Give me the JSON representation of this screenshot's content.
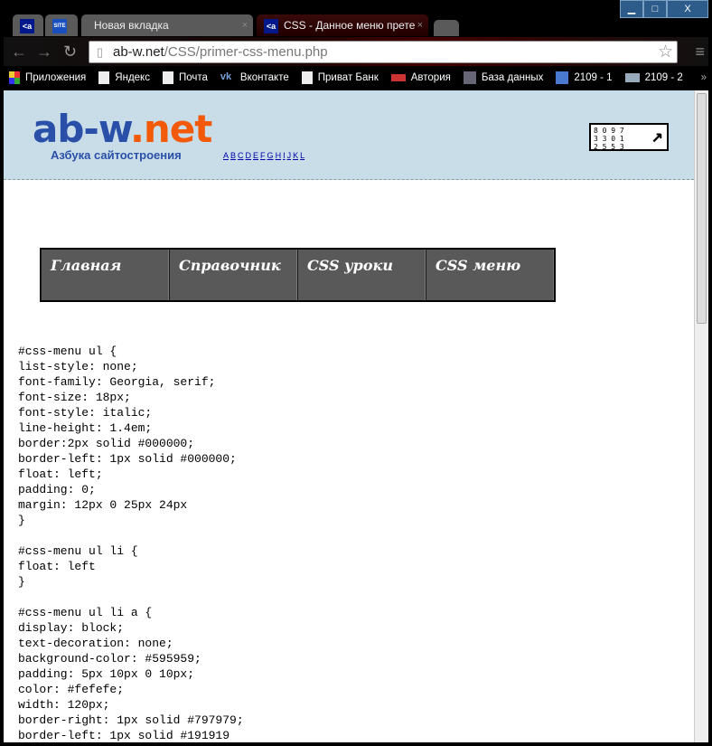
{
  "window": {
    "minimize": "▁",
    "maximize": "□",
    "close": "X"
  },
  "tabs": [
    {
      "label": "",
      "icon": "<a"
    },
    {
      "label": "",
      "icon": "SITE"
    },
    {
      "label": "Новая вкладка",
      "close": "×"
    },
    {
      "label": "CSS - Данное меню прете",
      "icon": "<a",
      "close": "×"
    }
  ],
  "address": {
    "host": "ab-w.net",
    "path": "/CSS/primer-css-menu.php"
  },
  "bookmarks": [
    "Приложения",
    "Яндекс",
    "Почта",
    "Вконтакте",
    "Приват Банк",
    "Автория",
    "База данных",
    "2109 - 1",
    "2109 - 2"
  ],
  "bookmarks_more": "»",
  "site": {
    "logo_main": "ab-w",
    "logo_dot": ".net",
    "tagline": "Азбука сайтостроения",
    "alphabet": [
      "A",
      "B",
      "C",
      "D",
      "E",
      "F",
      "G",
      "H",
      "I",
      "J",
      "K",
      "L"
    ],
    "counter": [
      "8 0 9 7",
      "3 3 0 1",
      "2 5 5 3"
    ],
    "counter_arrow": "↗"
  },
  "menu": [
    "Главная",
    "Справочник",
    "CSS уроки",
    "CSS меню"
  ],
  "code": [
    "#css-menu ul {",
    "list-style: none;",
    "font-family: Georgia, serif;",
    "font-size: 18px;",
    "font-style: italic;",
    "line-height: 1.4em;",
    "border:2px solid #000000;",
    "border-left: 1px solid #000000;",
    "float: left;",
    "padding: 0;",
    "margin: 12px 0 25px 24px",
    "}",
    "",
    "#css-menu ul li {",
    "float: left",
    "}",
    "",
    "#css-menu ul li a {",
    "display: block;",
    "text-decoration: none;",
    "background-color: #595959;",
    "padding: 5px 10px 0 10px;",
    "color: #fefefe;",
    "width: 120px;",
    "border-right: 1px solid #797979;",
    "border-left: 1px solid #191919"
  ]
}
